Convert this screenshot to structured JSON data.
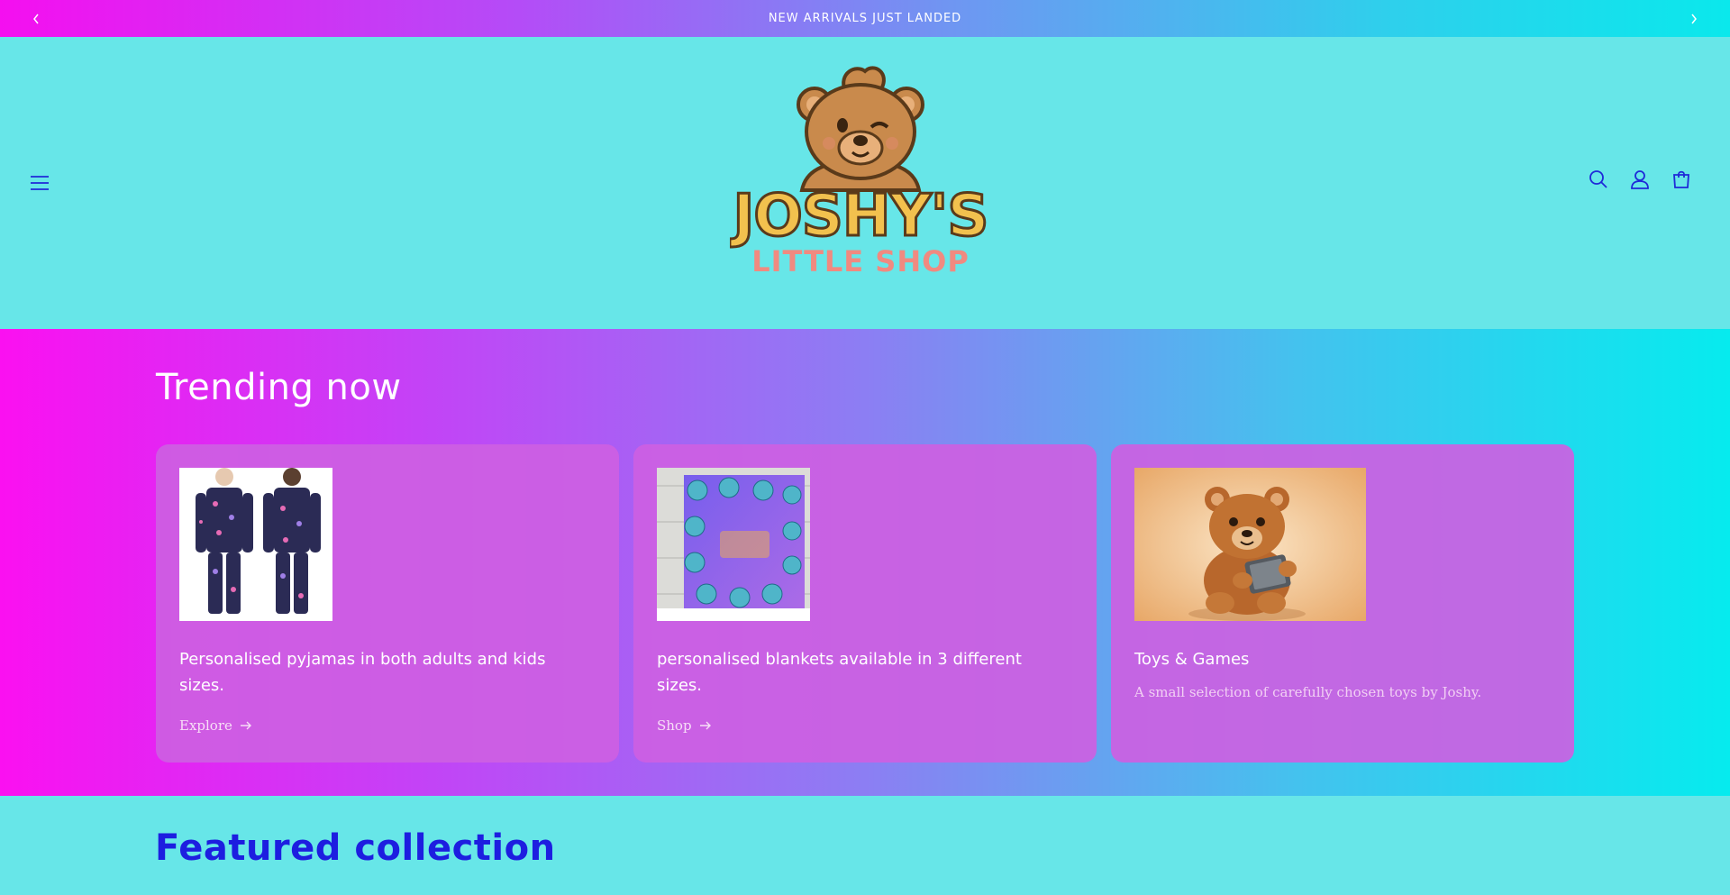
{
  "announcement": {
    "text": "NEW ARRIVALS JUST LANDED",
    "prev_icon": "chevron-left-icon",
    "next_icon": "chevron-right-icon"
  },
  "header": {
    "logo_title": "JOSHY'S",
    "logo_subtitle": "LITTLE SHOP",
    "menu_icon": "hamburger-icon",
    "icons": [
      "search-icon",
      "account-icon",
      "cart-icon"
    ]
  },
  "trending": {
    "title": "Trending now",
    "cards": [
      {
        "title": "Personalised pyjamas in both adults and kids sizes.",
        "link": "Explore",
        "image": "pyjamas"
      },
      {
        "title": "personalised blankets available in 3 different sizes.",
        "link": "Shop",
        "image": "blanket"
      },
      {
        "title": "Toys & Games",
        "description": "A small selection of carefully chosen toys by Joshy.",
        "image": "teddy-bear"
      }
    ]
  },
  "featured": {
    "title": "Featured collection"
  },
  "colors": {
    "accent": "#1f2ad8",
    "header_bg": "#67e6e8",
    "card_bg": "#cd60e2"
  }
}
